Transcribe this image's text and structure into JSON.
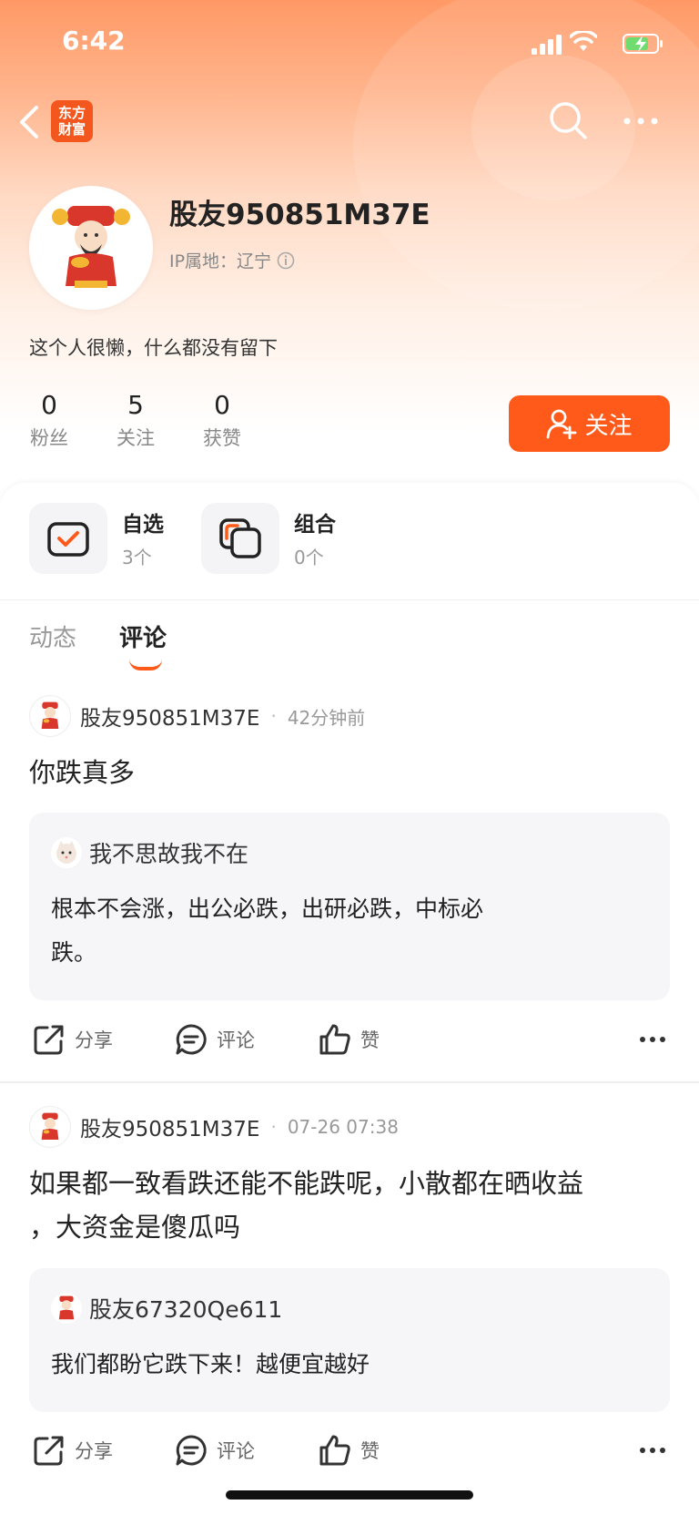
{
  "status_bar": {
    "time": "6:42"
  },
  "nav": {
    "logo_text": "东方财富"
  },
  "profile": {
    "name": "股友950851M37E",
    "ip_label": "IP属地：辽宁",
    "bio": "这个人很懒，什么都没有留下",
    "stats": [
      {
        "value": "0",
        "label": "粉丝"
      },
      {
        "value": "5",
        "label": "关注"
      },
      {
        "value": "0",
        "label": "获赞"
      }
    ],
    "follow_label": "关注"
  },
  "shortcuts": [
    {
      "title": "自选",
      "sub": "3个"
    },
    {
      "title": "组合",
      "sub": "0个"
    }
  ],
  "tabs": [
    {
      "label": "动态",
      "active": false
    },
    {
      "label": "评论",
      "active": true
    }
  ],
  "posts": [
    {
      "author": "股友950851M37E",
      "time": "42分钟前",
      "text": "你跌真多",
      "quote": {
        "author": "我不思故我不在",
        "text_lines": [
          "根本不会涨，出公必跌，出研必跌，中标必",
          "跌。"
        ]
      },
      "actions": {
        "share": "分享",
        "comment": "评论",
        "like": "赞"
      }
    },
    {
      "author": "股友950851M37E",
      "time": "07-26 07:38",
      "text_lines": [
        "如果都一致看跌还能不能跌呢，小散都在晒收益",
        "，大资金是傻瓜吗"
      ],
      "quote": {
        "author": "股友67320Qe611",
        "text_lines": [
          "我们都盼它跌下来！越便宜越好"
        ]
      },
      "actions": {
        "share": "分享",
        "comment": "评论",
        "like": "赞"
      }
    }
  ],
  "colors": {
    "accent": "#ff5a1a",
    "brand_logo": "#f3571e"
  }
}
